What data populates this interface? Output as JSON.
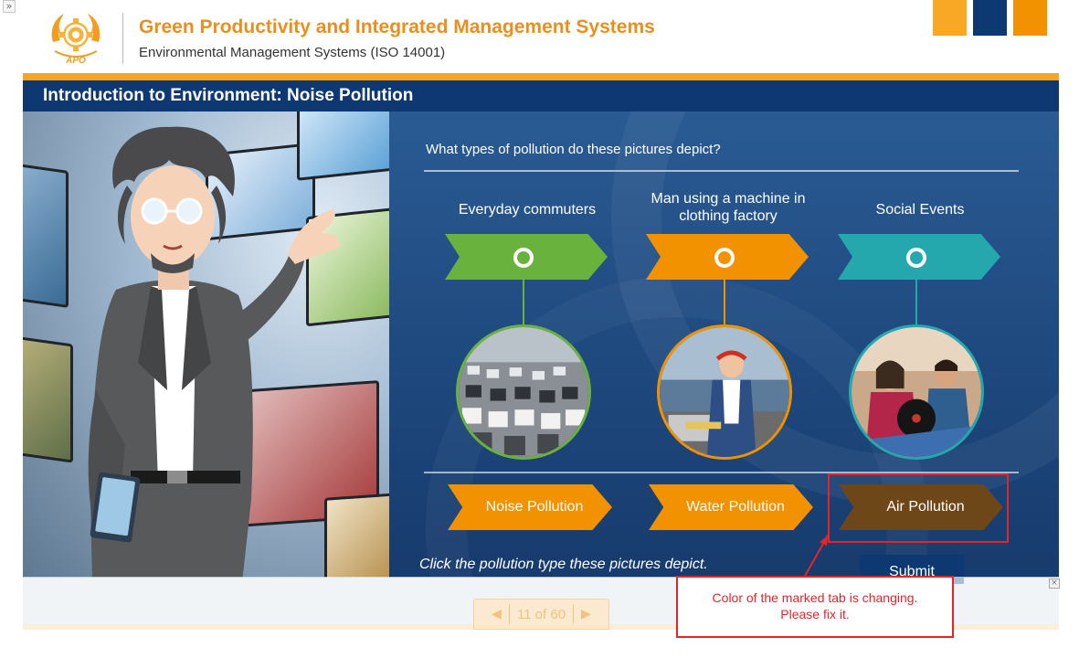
{
  "header": {
    "logo_text": "APO",
    "course_title": "Green Productivity and Integrated Management Systems",
    "course_subtitle": "Environmental Management Systems (ISO 14001)",
    "expand_glyph": "»",
    "brand_colors": [
      "#f9a825",
      "#0e3872",
      "#f39200"
    ]
  },
  "slide": {
    "title": "Introduction to Environment: Noise Pollution",
    "question": "What types of pollution do these pictures depict?",
    "pictures": [
      {
        "label": "Everyday commuters",
        "color": "#6ab23e",
        "icon": "traffic-photo"
      },
      {
        "label": "Man using a machine in clothing factory",
        "color": "#f39200",
        "icon": "factory-worker-photo"
      },
      {
        "label": "Social Events",
        "color": "#25a8ad",
        "icon": "social-party-photo"
      }
    ],
    "answers": [
      {
        "label": "Noise Pollution",
        "color": "#f39200"
      },
      {
        "label": "Water Pollution",
        "color": "#f39200"
      },
      {
        "label": "Air Pollution",
        "color": "#6e4719"
      }
    ],
    "instruction": "Click the pollution type these pictures depict.",
    "submit_label": "Submit"
  },
  "pager": {
    "prev_glyph": "◀",
    "label": "11 of 60",
    "next_glyph": "▶"
  },
  "close_glyph": "×",
  "annotation": {
    "line1": "Color of the marked tab is changing.",
    "line2": "Please fix it.",
    "color": "#e0262b"
  }
}
